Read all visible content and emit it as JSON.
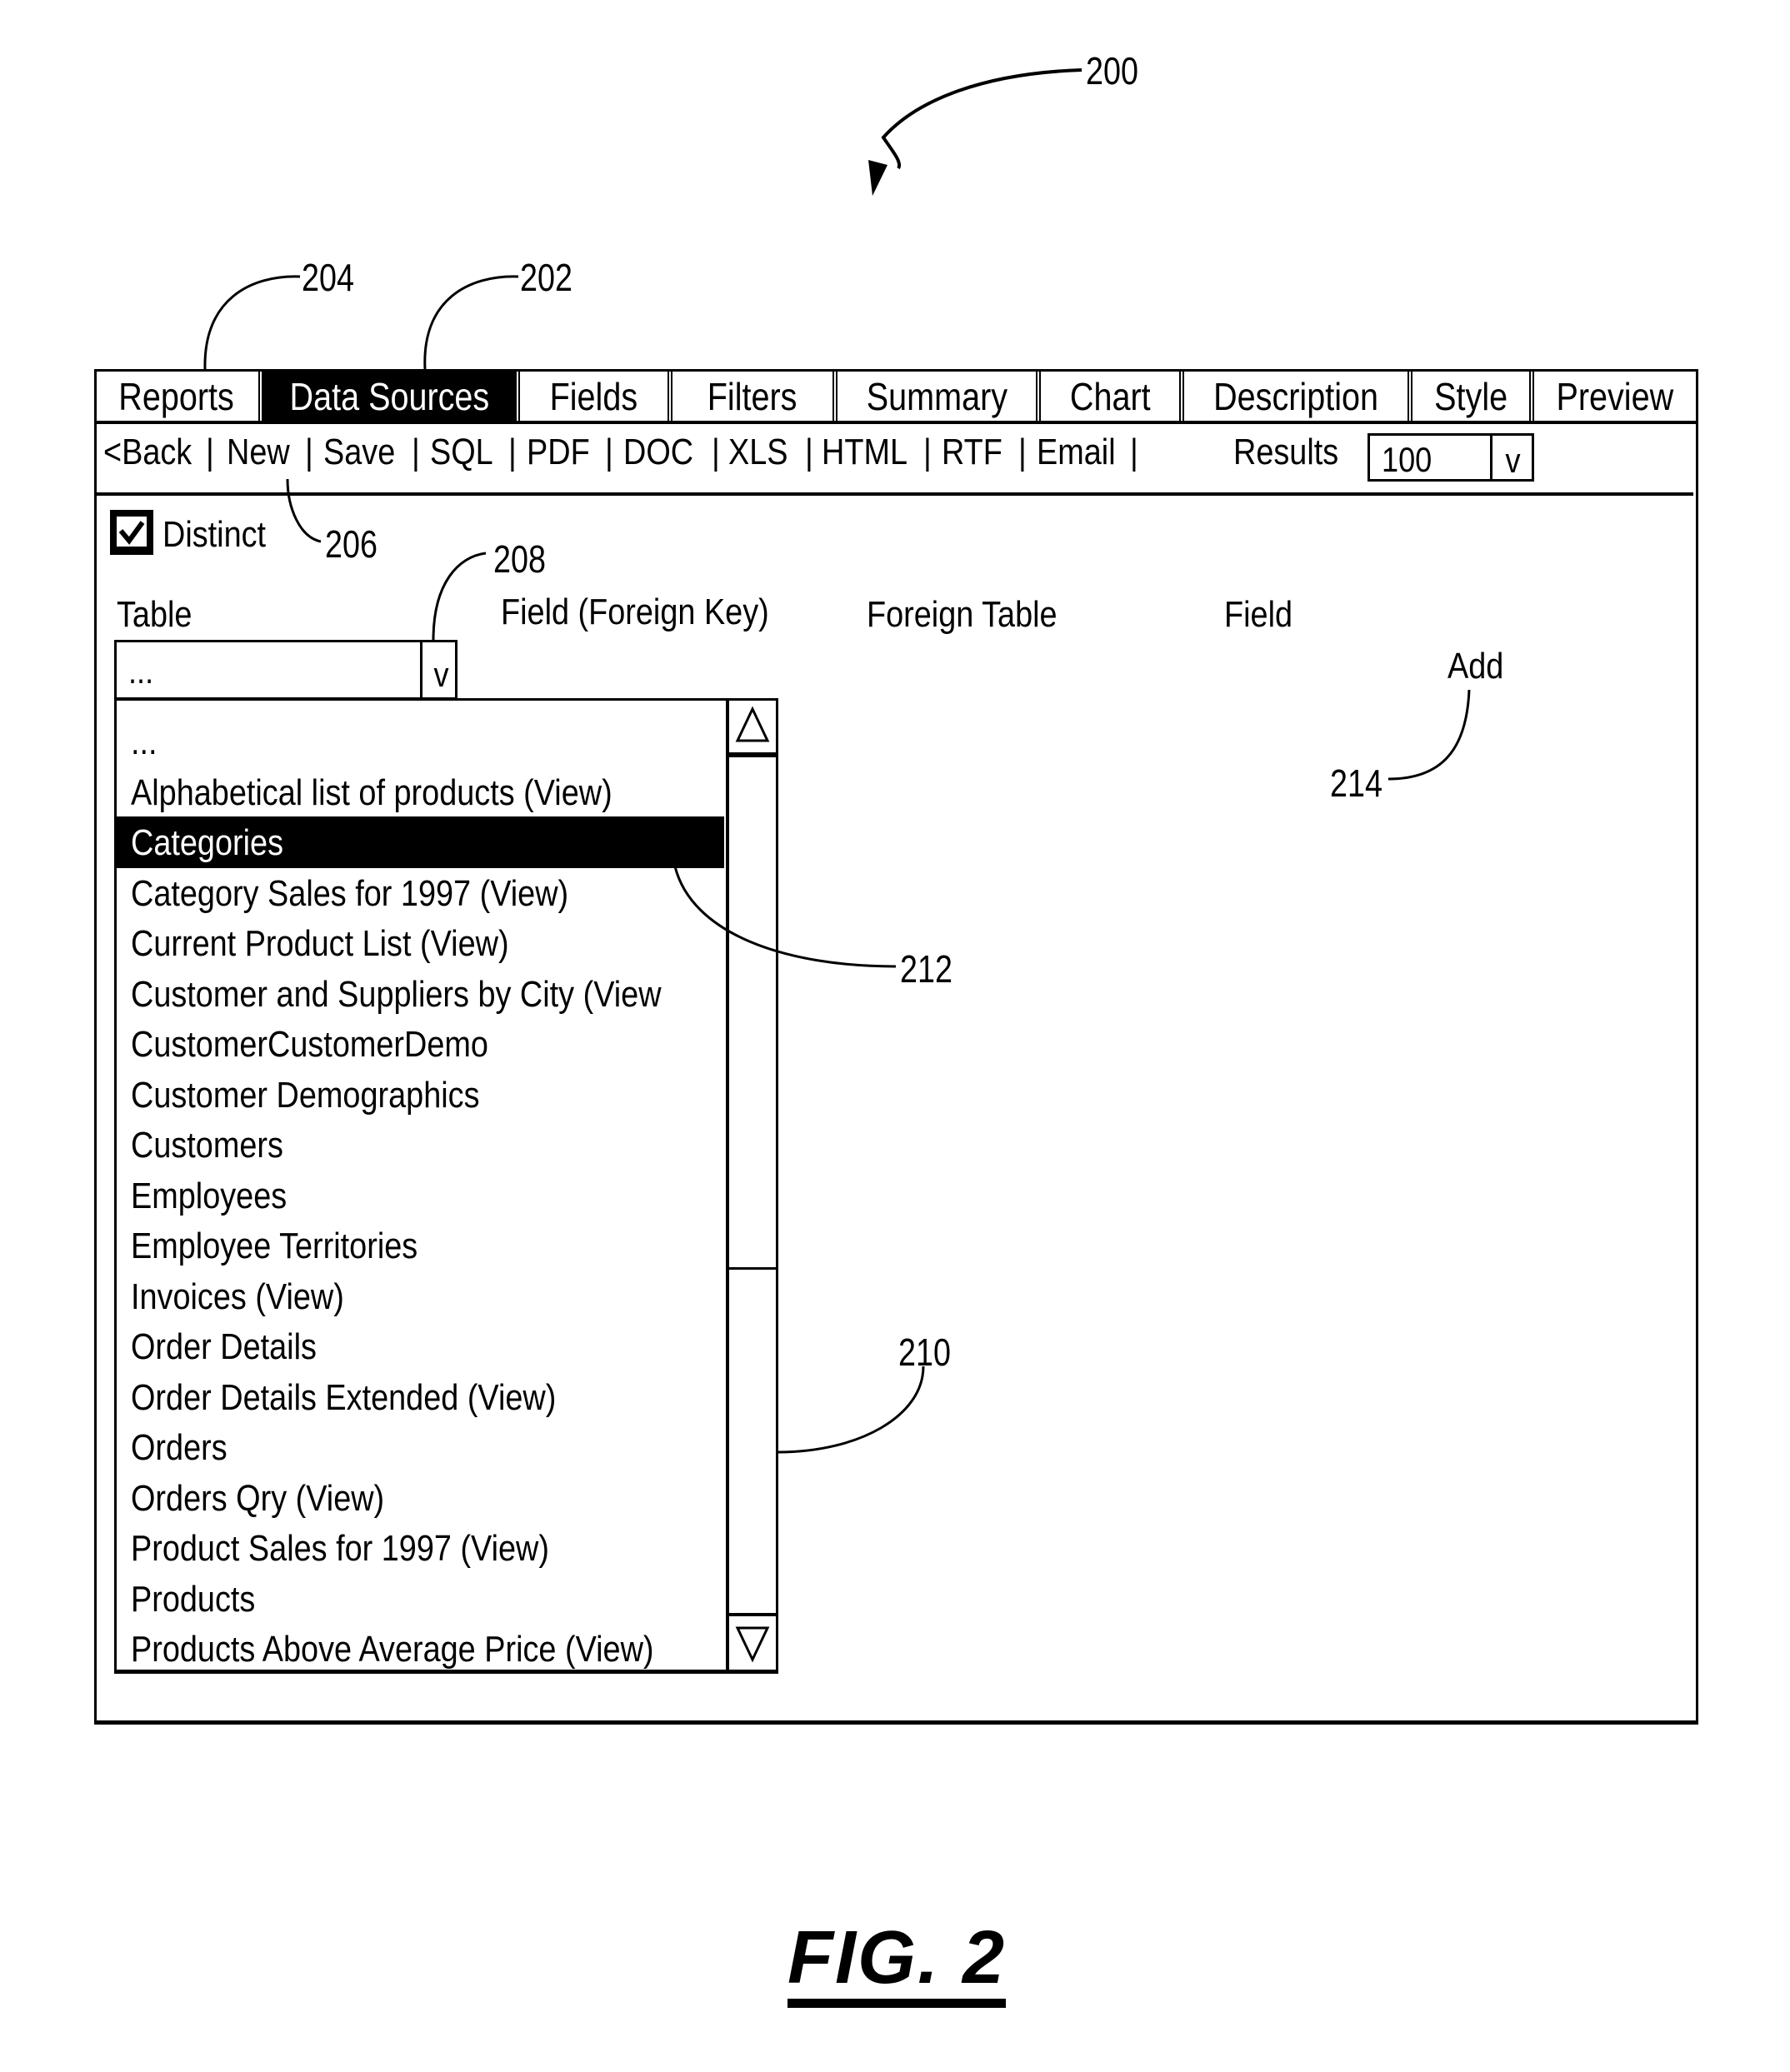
{
  "figure": {
    "label": "FIG. 2",
    "reference_numerals": {
      "screen": "200",
      "data_sources_tab": "202",
      "tab_bar": "204",
      "distinct_checkbox": "206",
      "table_dropdown": "208",
      "table_list": "210",
      "selected_table": "212",
      "add_link": "214"
    }
  },
  "tabs": [
    {
      "label": "Reports",
      "active": false
    },
    {
      "label": "Data Sources",
      "active": true
    },
    {
      "label": "Fields",
      "active": false
    },
    {
      "label": "Filters",
      "active": false
    },
    {
      "label": "Summary",
      "active": false
    },
    {
      "label": "Chart",
      "active": false
    },
    {
      "label": "Description",
      "active": false
    },
    {
      "label": "Style",
      "active": false
    },
    {
      "label": "Preview",
      "active": false
    }
  ],
  "toolbar": {
    "items": [
      "<Back",
      "New",
      "Save",
      "SQL",
      "PDF",
      "DOC",
      "XLS",
      "HTML",
      "RTF",
      "Email"
    ],
    "separator": "|",
    "results_label": "Results",
    "results_value": "100",
    "dropdown_caret": "v"
  },
  "options": {
    "distinct_label": "Distinct",
    "distinct_checked": true
  },
  "columns": {
    "table": "Table",
    "field_foreign_key": "Field (Foreign Key)",
    "foreign_table": "Foreign Table",
    "field": "Field",
    "add": "Add"
  },
  "table_select": {
    "value": "...",
    "caret": "v"
  },
  "table_list": {
    "selected_index": 2,
    "items": [
      "...",
      "Alphabetical list of products (View)",
      "Categories",
      "Category Sales for 1997 (View)",
      "Current Product List (View)",
      "Customer and Suppliers by City (View",
      "CustomerCustomerDemo",
      "Customer Demographics",
      "Customers",
      "Employees",
      "Employee Territories",
      "Invoices (View)",
      "Order Details",
      "Order Details Extended (View)",
      "Orders",
      "Orders Qry (View)",
      "Product Sales for 1997 (View)",
      "Products",
      "Products Above Average Price (View)"
    ]
  }
}
